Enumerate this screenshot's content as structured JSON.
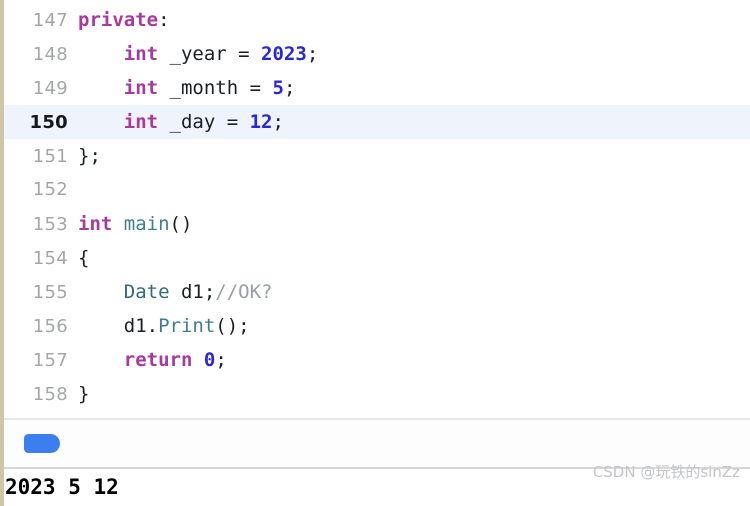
{
  "editor": {
    "gutter_marker": "left-rail",
    "current_line": 150,
    "lines": [
      {
        "number": "147",
        "indent": "",
        "tokens": [
          {
            "t": "kw",
            "v": "private"
          },
          {
            "t": "punc",
            "v": ":"
          }
        ]
      },
      {
        "number": "148",
        "indent": "    ",
        "tokens": [
          {
            "t": "kw",
            "v": "int"
          },
          {
            "t": "plain",
            "v": " _year = "
          },
          {
            "t": "num",
            "v": "2023"
          },
          {
            "t": "punc",
            "v": ";"
          }
        ]
      },
      {
        "number": "149",
        "indent": "    ",
        "tokens": [
          {
            "t": "kw",
            "v": "int"
          },
          {
            "t": "plain",
            "v": " _month = "
          },
          {
            "t": "num",
            "v": "5"
          },
          {
            "t": "punc",
            "v": ";"
          }
        ]
      },
      {
        "number": "150",
        "indent": "    ",
        "tokens": [
          {
            "t": "kw",
            "v": "int"
          },
          {
            "t": "plain",
            "v": " _day = "
          },
          {
            "t": "num",
            "v": "12"
          },
          {
            "t": "punc",
            "v": ";"
          }
        ]
      },
      {
        "number": "151",
        "indent": "",
        "tokens": [
          {
            "t": "punc",
            "v": "};"
          }
        ]
      },
      {
        "number": "152",
        "indent": "",
        "tokens": []
      },
      {
        "number": "153",
        "indent": "",
        "tokens": [
          {
            "t": "kw",
            "v": "int"
          },
          {
            "t": "plain",
            "v": " "
          },
          {
            "t": "fn",
            "v": "main"
          },
          {
            "t": "punc",
            "v": "()"
          }
        ]
      },
      {
        "number": "154",
        "indent": "",
        "tokens": [
          {
            "t": "punc",
            "v": "{"
          }
        ]
      },
      {
        "number": "155",
        "indent": "    ",
        "tokens": [
          {
            "t": "type",
            "v": "Date"
          },
          {
            "t": "plain",
            "v": " d1;"
          },
          {
            "t": "cmt",
            "v": "//OK?"
          }
        ]
      },
      {
        "number": "156",
        "indent": "    ",
        "tokens": [
          {
            "t": "plain",
            "v": "d1."
          },
          {
            "t": "fn",
            "v": "Print"
          },
          {
            "t": "punc",
            "v": "();"
          }
        ]
      },
      {
        "number": "157",
        "indent": "    ",
        "tokens": [
          {
            "t": "kw",
            "v": "return"
          },
          {
            "t": "plain",
            "v": " "
          },
          {
            "t": "num",
            "v": "0"
          },
          {
            "t": "punc",
            "v": ";"
          }
        ]
      },
      {
        "number": "158",
        "indent": "",
        "tokens": [
          {
            "t": "punc",
            "v": "}"
          }
        ]
      }
    ]
  },
  "tag_row": {
    "tag_name": "blue-tag",
    "tag_color": "#3b7ef0"
  },
  "console": {
    "output": "2023 5 12"
  },
  "watermark": {
    "text": "CSDN @玩铁的sinZz"
  },
  "colors": {
    "keyword": "#a939a0",
    "number": "#2727d6",
    "type": "#2f6b76",
    "function": "#3e7f8c",
    "comment": "#9a9ea2",
    "plain": "#1b1f23",
    "current_line_bg": "#eef3fc",
    "lineno": "#a4a6a8",
    "left_rail": "#cfc6a8",
    "accent": "#3b7ef0"
  }
}
